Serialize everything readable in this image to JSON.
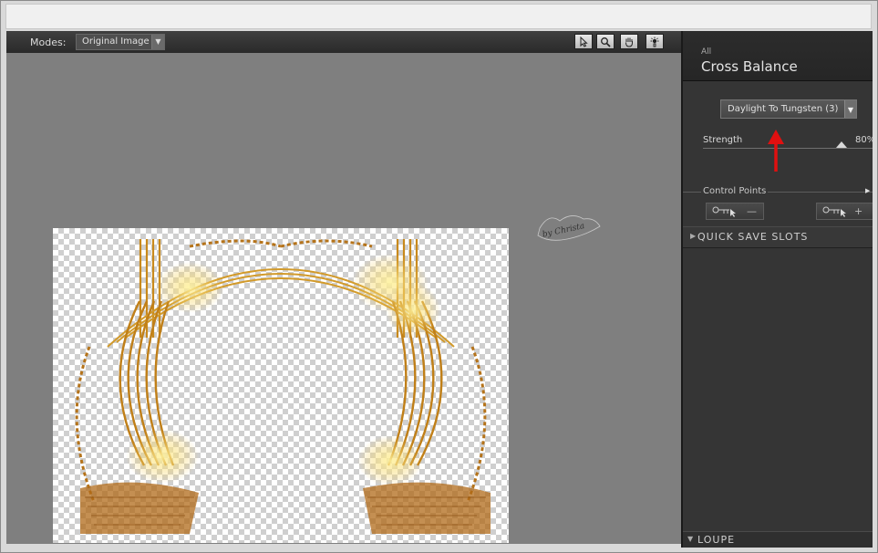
{
  "toolbar": {
    "modes_label": "Modes:",
    "modes_value": "Original Image",
    "tools": [
      "arrow-pointer-icon",
      "zoom-icon",
      "hand-icon",
      "light-icon"
    ]
  },
  "panel": {
    "category": "All",
    "title": "Cross Balance",
    "preset": "Daylight To Tungsten (3)",
    "strength_label": "Strength",
    "strength_value": "80%",
    "strength_fraction": 0.8,
    "control_points_label": "Control Points",
    "quick_save_label": "QUICK SAVE SLOTS",
    "loupe_label": "LOUPE"
  },
  "colors": {
    "canvas_bg": "#7f7f7f",
    "panel_bg": "#353535",
    "frame_gold": "#c8891c",
    "annotation_red": "#e01010"
  },
  "watermark": {
    "text": "by Christa"
  }
}
